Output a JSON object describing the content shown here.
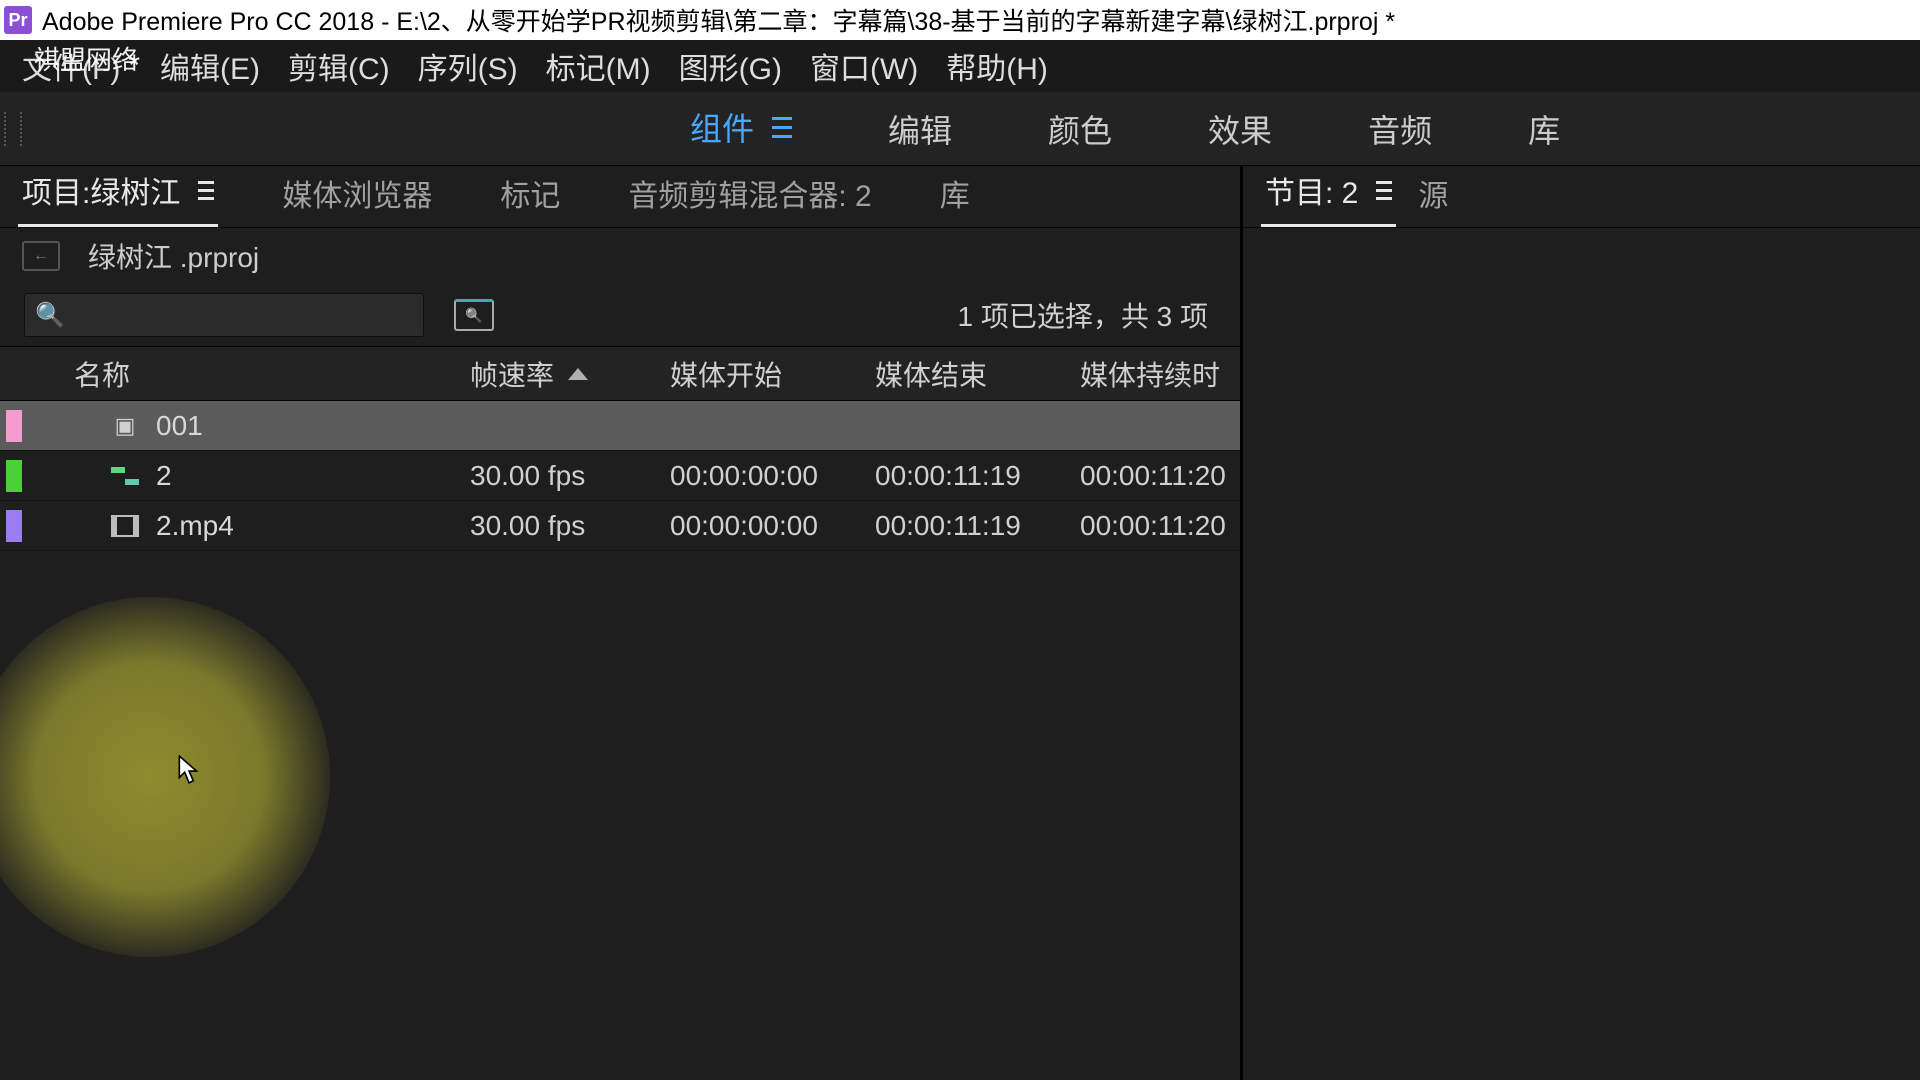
{
  "title": "Adobe Premiere Pro CC 2018 - E:\\2、从零开始学PR视频剪辑\\第二章：字幕篇\\38-基于当前的字幕新建字幕\\绿树江.prproj *",
  "watermark": "祺盟网络",
  "menus": [
    "文件(F)",
    "编辑(E)",
    "剪辑(C)",
    "序列(S)",
    "标记(M)",
    "图形(G)",
    "窗口(W)",
    "帮助(H)"
  ],
  "workspaces": {
    "items": [
      "组件",
      "编辑",
      "颜色",
      "效果",
      "音频",
      "库"
    ],
    "active_index": 0
  },
  "left_tabs": {
    "items": [
      "项目:绿树江",
      "媒体浏览器",
      "标记",
      "音频剪辑混合器: 2",
      "库"
    ],
    "active_index": 0
  },
  "right_tabs": {
    "items": [
      "节目: 2",
      "源"
    ],
    "active_index": 0
  },
  "project_file": "绿树江 .prproj",
  "search_placeholder": "",
  "status": "1 项已选择，共 3 项",
  "columns": [
    "名称",
    "帧速率",
    "媒体开始",
    "媒体结束",
    "媒体持续时"
  ],
  "rows": [
    {
      "color": "chip-pink",
      "icon": "title",
      "name": "001",
      "fps": "",
      "start": "",
      "end": "",
      "dur": "",
      "selected": true
    },
    {
      "color": "chip-green",
      "icon": "sequence",
      "name": "2",
      "fps": "30.00 fps",
      "start": "00:00:00:00",
      "end": "00:00:11:19",
      "dur": "00:00:11:20",
      "selected": false
    },
    {
      "color": "chip-purple",
      "icon": "clip",
      "name": "2.mp4",
      "fps": "30.00 fps",
      "start": "00:00:00:00",
      "end": "00:00:11:19",
      "dur": "00:00:11:20",
      "selected": false
    }
  ]
}
